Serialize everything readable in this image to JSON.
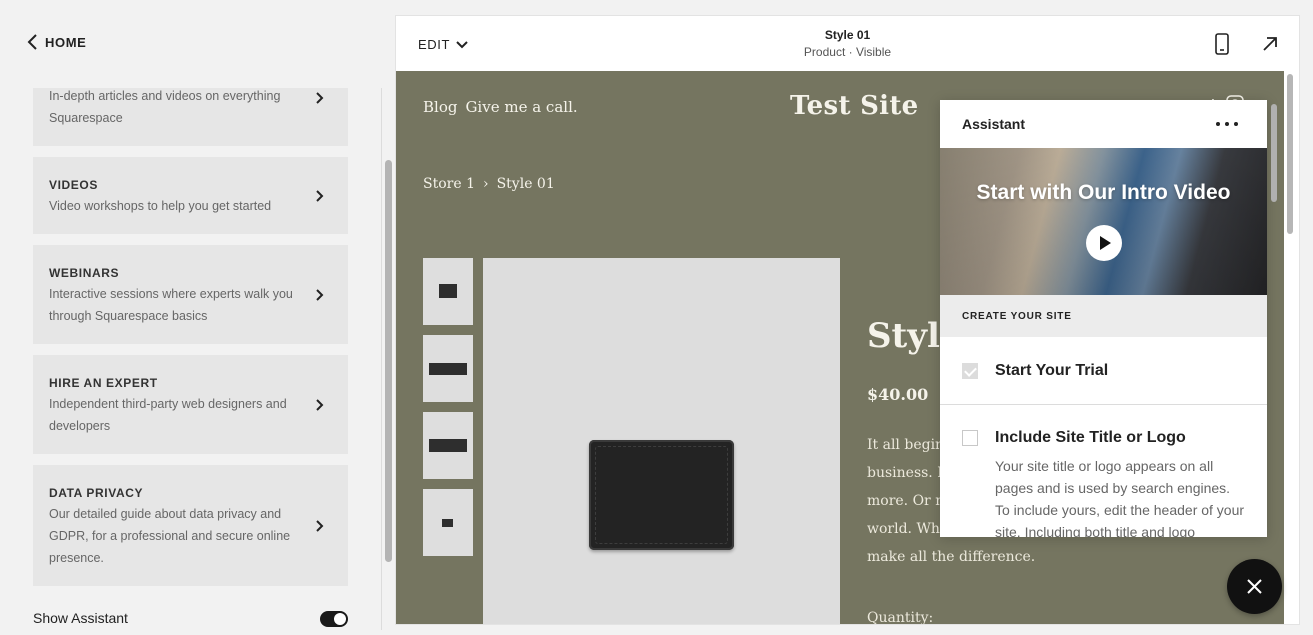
{
  "left_panel": {
    "home_label": "HOME",
    "cards": [
      {
        "title": "",
        "desc": "In-depth articles and videos on everything Squarespace"
      },
      {
        "title": "VIDEOS",
        "desc": "Video workshops to help you get started"
      },
      {
        "title": "WEBINARS",
        "desc": "Interactive sessions where experts walk you through Squarespace basics"
      },
      {
        "title": "HIRE AN EXPERT",
        "desc": "Independent third-party web designers and developers"
      },
      {
        "title": "DATA PRIVACY",
        "desc": "Our detailed guide about data privacy and GDPR, for a professional and secure online presence."
      }
    ],
    "show_assistant_label": "Show Assistant",
    "show_assistant_on": true
  },
  "topbar": {
    "edit_label": "EDIT",
    "page_title": "Style 01",
    "page_subtitle": "Product · Visible"
  },
  "site": {
    "nav": [
      "Blog",
      "Give me a call."
    ],
    "title": "Test Site",
    "breadcrumb": [
      "Store 1",
      "›",
      "Style 01"
    ],
    "product_name": "Style",
    "price": "$40.00",
    "description_lines": [
      "It all begins",
      "business. M",
      "more. Or m",
      "world. Wha",
      "make all the difference."
    ],
    "quantity_label": "Quantity:"
  },
  "assistant": {
    "title": "Assistant",
    "video_title": "Start with Our Intro Video",
    "section_label": "CREATE YOUR SITE",
    "tasks": [
      {
        "title": "Start Your Trial",
        "done": true
      },
      {
        "title": "Include Site Title or Logo",
        "done": false,
        "desc": "Your site title or logo appears on all pages and is used by search engines. To include yours, edit the header of your site. Including both title and logo"
      }
    ]
  },
  "icons": {
    "home_back": "chevron-left-icon",
    "edit_caret": "chevron-down-icon",
    "mobile_preview": "mobile-phone-icon",
    "expand": "arrow-up-right-icon",
    "more": "more-horizontal-icon",
    "play": "play-icon",
    "close": "close-icon"
  }
}
